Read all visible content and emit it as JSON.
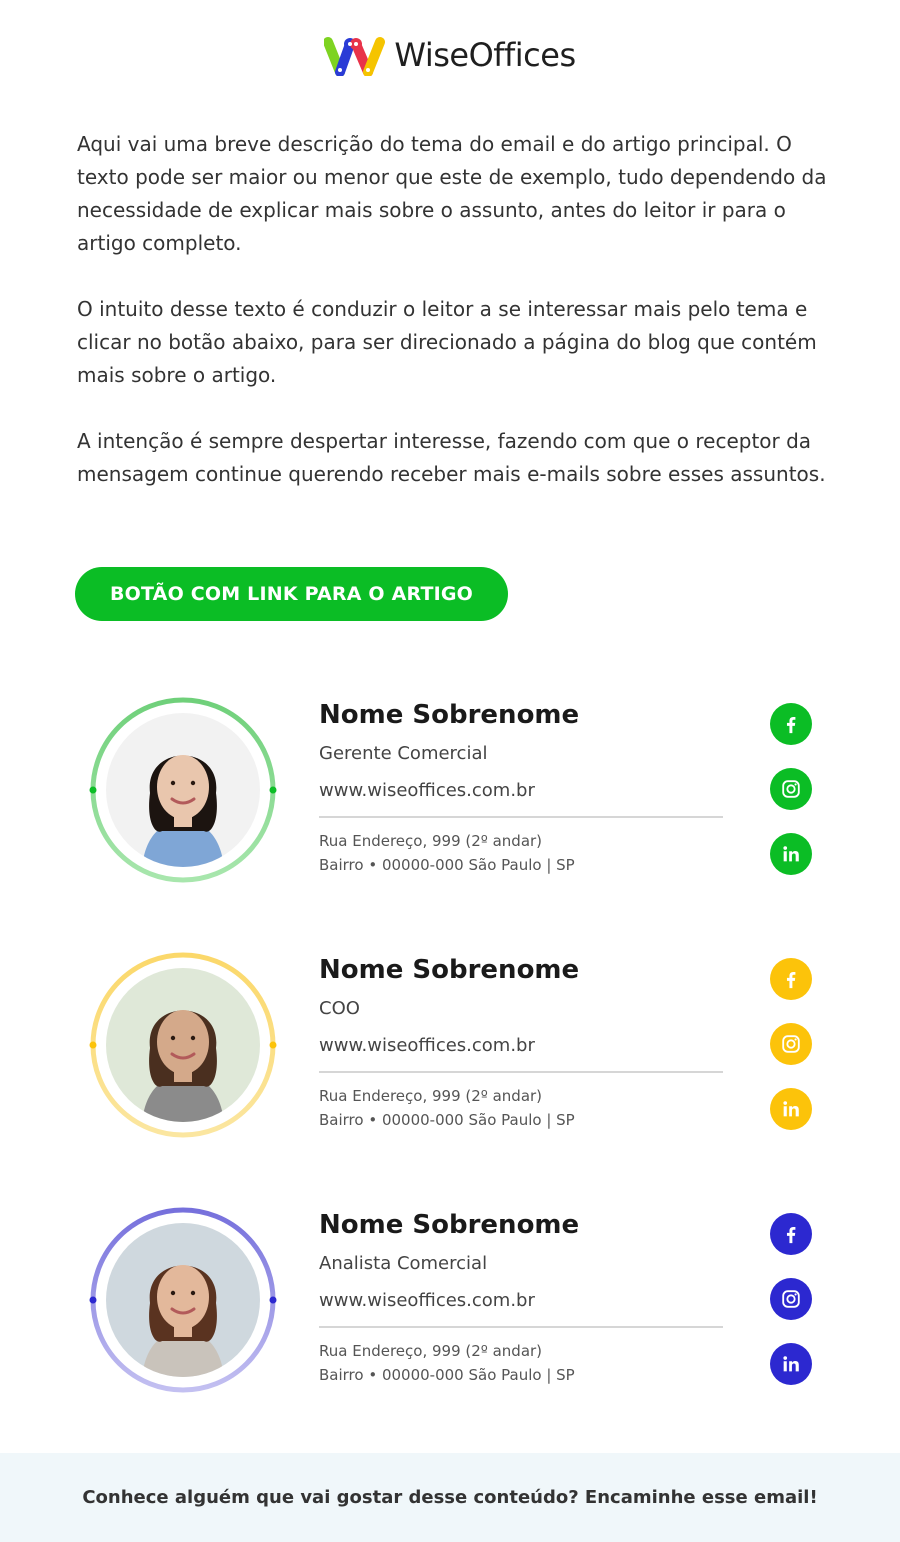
{
  "brand": {
    "name": "WiseOffices",
    "colors": {
      "green": "#7ed321",
      "blue": "#2a3bd6",
      "red": "#e8334a",
      "yellow": "#f5c400"
    }
  },
  "intro": {
    "paragraphs": [
      "Aqui vai uma breve descrição do tema do email e do artigo principal. O texto pode ser maior ou menor que este de exemplo, tudo dependendo da necessidade de explicar mais sobre o assunto, antes do leitor ir para o artigo completo.",
      "O intuito desse texto é conduzir o leitor a se interessar mais pelo tema e clicar no botão abaixo, para ser direcionado a página do blog que contém mais sobre o artigo.",
      "A intenção é sempre despertar interesse, fazendo com que o receptor da mensagem continue querendo receber mais e-mails sobre esses assuntos."
    ]
  },
  "cta": {
    "label": "BOTÃO COM LINK PARA O ARTIGO",
    "color": "#0bbd25"
  },
  "cards": [
    {
      "name": "Nome Sobrenome",
      "role": "Gerente Comercial",
      "website": "www.wiseoffices.com.br",
      "address_line1": "Rua Endereço, 999 (2º andar)",
      "address_line2": "Bairro • 00000-000 São Paulo | SP",
      "accent": "#0bbd25",
      "ring_top": "#6fd07a",
      "ring_bottom": "#a8e6ad",
      "icons": [
        "facebook-icon",
        "instagram-icon",
        "linkedin-icon"
      ]
    },
    {
      "name": "Nome Sobrenome",
      "role": "COO",
      "website": "www.wiseoffices.com.br",
      "address_line1": "Rua Endereço, 999 (2º andar)",
      "address_line2": "Bairro • 00000-000 São Paulo | SP",
      "accent": "#fcc30a",
      "ring_top": "#fbd86a",
      "ring_bottom": "#fbe6a0",
      "icons": [
        "facebook-icon",
        "instagram-icon",
        "linkedin-icon"
      ]
    },
    {
      "name": "Nome Sobrenome",
      "role": "Analista Comercial",
      "website": "www.wiseoffices.com.br",
      "address_line1": "Rua Endereço, 999 (2º andar)",
      "address_line2": "Bairro • 00000-000 São Paulo | SP",
      "accent": "#2c28d0",
      "ring_top": "#7670dc",
      "ring_bottom": "#c3c0f1",
      "icons": [
        "facebook-icon",
        "instagram-icon",
        "linkedin-icon"
      ]
    }
  ],
  "footer": {
    "text": "Conhece alguém que vai gostar desse conteúdo? Encaminhe esse email!"
  }
}
